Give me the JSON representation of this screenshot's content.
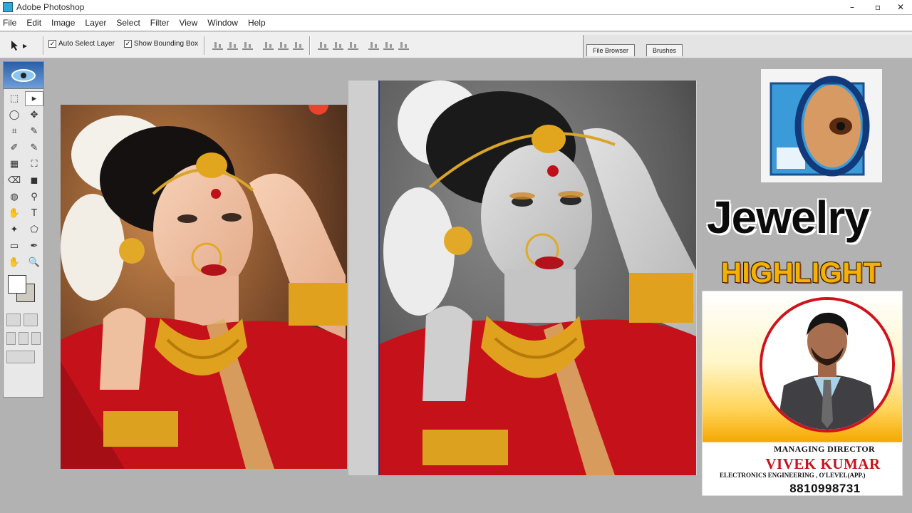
{
  "window": {
    "title": "Adobe Photoshop",
    "minimize": "–",
    "maximize": "▫",
    "close": "✕"
  },
  "menu": [
    "File",
    "Edit",
    "Image",
    "Layer",
    "Select",
    "Filter",
    "View",
    "Window",
    "Help"
  ],
  "options": {
    "tool_arrow": "▸",
    "auto_select_layer": "Auto Select Layer",
    "auto_select_checked": "✓",
    "show_bounding_box": "Show Bounding Box",
    "show_bounding_checked": "✓",
    "tab_file_browser": "File Browser",
    "tab_brushes": "Brushes"
  },
  "tools": [
    "⬚",
    "▸",
    "◯",
    "✥",
    "⌗",
    "✎",
    "✐",
    "✎",
    "▦",
    "⛶",
    "⌫",
    "◼",
    "◍",
    "⚲",
    "✋",
    "T",
    "✦",
    "⬠",
    "▭",
    "✒",
    "✋",
    "🔍"
  ],
  "overlay": {
    "title": "Jewelry",
    "subtitle": "HIGHLIGHT"
  },
  "card": {
    "role": "MANAGING DIRECTOR",
    "name": "VIVEK KUMAR",
    "qualification": "ELECTRONICS ENGINEERING , O'LEVEL(APP.)",
    "phone": "8810998731"
  },
  "colors": {
    "accent_red": "#d0121c",
    "highlight_gold": "#f3b200",
    "title_black": "#0b0b0b"
  }
}
